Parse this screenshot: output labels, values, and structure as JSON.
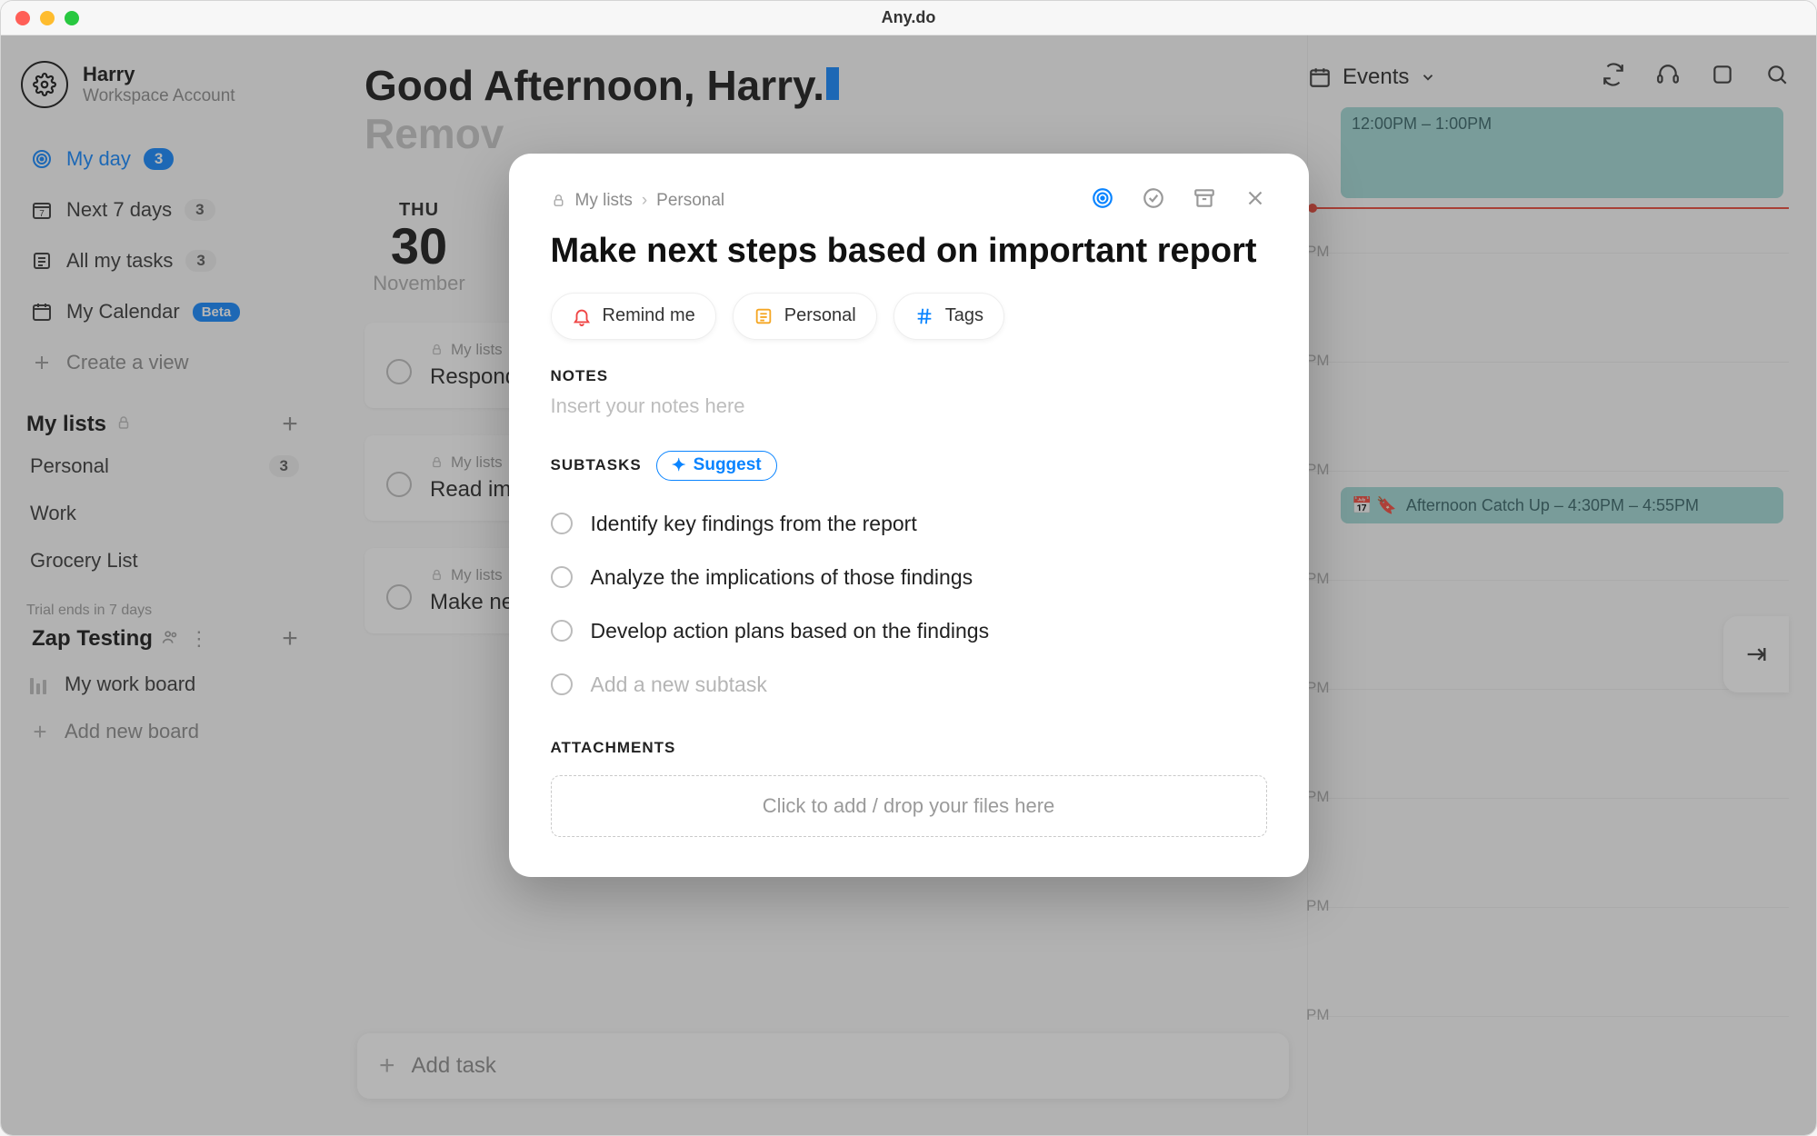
{
  "window": {
    "title": "Any.do"
  },
  "profile": {
    "name": "Harry",
    "subtitle": "Workspace Account"
  },
  "nav": {
    "myday": {
      "label": "My day",
      "count": "3"
    },
    "next7": {
      "label": "Next 7 days",
      "count": "3"
    },
    "alltasks": {
      "label": "All my tasks",
      "count": "3"
    },
    "calendar": {
      "label": "My Calendar",
      "badge": "Beta"
    },
    "createview": {
      "label": "Create a view"
    }
  },
  "lists_section": {
    "title": "My lists"
  },
  "lists": {
    "personal": {
      "label": "Personal",
      "count": "3"
    },
    "work": {
      "label": "Work"
    },
    "grocery": {
      "label": "Grocery List"
    }
  },
  "trial": {
    "note": "Trial ends in 7 days",
    "team": "Zap Testing"
  },
  "boards": {
    "mywork": {
      "label": "My work board"
    },
    "addnew": {
      "label": "Add new board"
    }
  },
  "greeting": {
    "line1_a": "Good Afternoon, Harry",
    "line1_b": ".",
    "line2": "Remov"
  },
  "date": {
    "dow": "THU",
    "num": "30",
    "month": "November"
  },
  "bg_tasks": {
    "crumb": "My lists",
    "t1": "Respond",
    "t2": "Read im",
    "t3": "Make ne"
  },
  "right": {
    "events": "Events",
    "hours": {
      "h12": "12:00PM – 1:00PM",
      "h1": "PM",
      "h2": "PM",
      "h3": "PM",
      "h4": "PM",
      "h5": "PM",
      "h6": "PM",
      "h7": "PM",
      "h8": "PM"
    },
    "event2": "Afternoon Catch Up – 4:30PM – 4:55PM"
  },
  "addtask": {
    "label": "Add task"
  },
  "modal": {
    "crumb_root": "My lists",
    "crumb_leaf": "Personal",
    "title": "Make next steps based on important report",
    "chips": {
      "remind": "Remind me",
      "personal": "Personal",
      "tags": "Tags"
    },
    "notes_label": "NOTES",
    "notes_ph": "Insert your notes here",
    "subtasks_label": "SUBTASKS",
    "suggest": "Suggest",
    "sub1": "Identify key findings from the report",
    "sub2": "Analyze the implications of those findings",
    "sub3": "Develop action plans based on the findings",
    "sub_add": "Add a new subtask",
    "attach_label": "ATTACHMENTS",
    "attach_ph": "Click to add / drop your files here"
  }
}
